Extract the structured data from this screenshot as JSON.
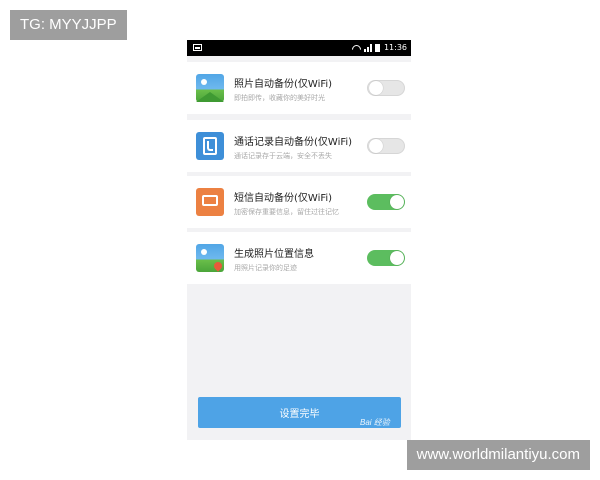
{
  "watermarks": {
    "top_left": "TG: MYYJJPP",
    "bottom_right": "www.worldmilantiyu.com"
  },
  "status_bar": {
    "time": "11:36",
    "icons": [
      "image-icon",
      "wifi-icon",
      "signal-icon",
      "battery-icon"
    ]
  },
  "settings": [
    {
      "icon": "photo-icon",
      "title": "照片自动备份(仅WiFi)",
      "subtitle": "即拍即传，收藏你的美好时光",
      "enabled": false
    },
    {
      "icon": "contact-icon",
      "title": "通话记录自动备份(仅WiFi)",
      "subtitle": "通话记录存于云端，安全不丢失",
      "enabled": false
    },
    {
      "icon": "sms-icon",
      "title": "短信自动备份(仅WiFi)",
      "subtitle": "加密保存重要信息，留住过往记忆",
      "enabled": true
    },
    {
      "icon": "location-icon",
      "title": "生成照片位置信息",
      "subtitle": "用照片记录你的足迹",
      "enabled": true
    }
  ],
  "done_button": {
    "label": "设置完毕"
  },
  "logo_text": "Bai 经验",
  "colors": {
    "toggle_on": "#5cbd5f",
    "button": "#4ea3e6"
  }
}
